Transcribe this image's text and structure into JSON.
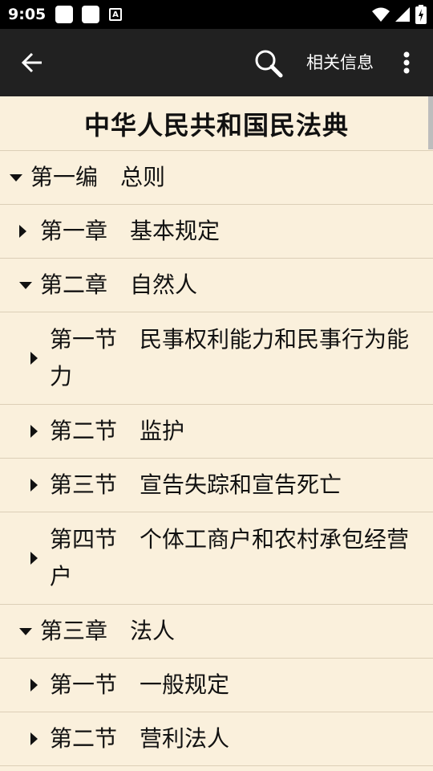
{
  "status_bar": {
    "time": "9:05",
    "notification_letter": "A",
    "icons": [
      "wifi-icon",
      "signal-icon",
      "battery-icon"
    ]
  },
  "app_bar": {
    "back_icon": "arrow-left-icon",
    "search_icon": "search-icon",
    "related_label": "相关信息",
    "more_icon": "more-vert-icon"
  },
  "document": {
    "title": "中华人民共和国民法典",
    "toc": [
      {
        "label": "第一编　总则",
        "state": "expanded",
        "level": 0
      },
      {
        "label": "第一章　基本规定",
        "state": "collapsed",
        "level": 1
      },
      {
        "label": "第二章　自然人",
        "state": "expanded",
        "level": 1
      },
      {
        "label": "第一节　民事权利能力和民事行为能力",
        "state": "collapsed",
        "level": 2
      },
      {
        "label": "第二节　监护",
        "state": "collapsed",
        "level": 2
      },
      {
        "label": "第三节　宣告失踪和宣告死亡",
        "state": "collapsed",
        "level": 2
      },
      {
        "label": "第四节　个体工商户和农村承包经营户",
        "state": "collapsed",
        "level": 2
      },
      {
        "label": "第三章　法人",
        "state": "expanded",
        "level": 1
      },
      {
        "label": "第一节　一般规定",
        "state": "collapsed",
        "level": 2
      },
      {
        "label": "第二节　营利法人",
        "state": "collapsed",
        "level": 2
      }
    ]
  },
  "colors": {
    "background": "#FAF0DC",
    "app_bar": "#212121",
    "divider": "#DCCFB7"
  }
}
